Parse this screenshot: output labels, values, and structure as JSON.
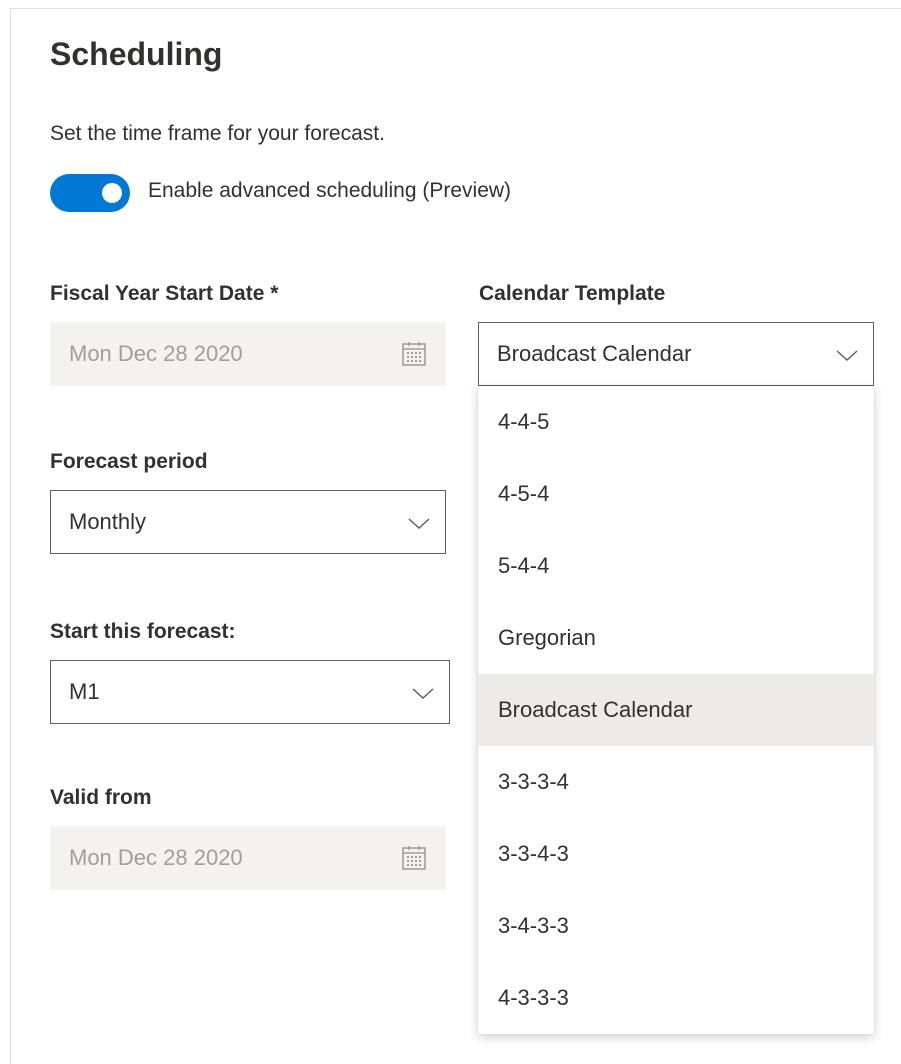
{
  "header": {
    "title": "Scheduling",
    "subtitle": "Set the time frame for your forecast."
  },
  "toggle": {
    "label": "Enable advanced scheduling (Preview)",
    "state": "on",
    "color": "#0078d4"
  },
  "fields": {
    "fiscal_year_start": {
      "label": "Fiscal Year Start Date *",
      "value": "Mon Dec 28 2020",
      "disabled": true,
      "icon": "calendar-icon"
    },
    "calendar_template": {
      "label": "Calendar Template",
      "value": "Broadcast Calendar",
      "icon": "chevron-down-icon",
      "expanded": true
    },
    "forecast_period": {
      "label": "Forecast period",
      "value": "Monthly",
      "icon": "chevron-down-icon"
    },
    "start_forecast": {
      "label": "Start this forecast:",
      "value": "M1",
      "icon": "chevron-down-icon"
    },
    "valid_from": {
      "label": "Valid from",
      "value": "Mon Dec 28 2020",
      "disabled": true,
      "icon": "calendar-icon"
    }
  },
  "dropdown": {
    "options": [
      "4-4-5",
      "4-5-4",
      "5-4-4",
      "Gregorian",
      "Broadcast Calendar",
      "3-3-3-4",
      "3-3-4-3",
      "3-4-3-3",
      "4-3-3-3"
    ],
    "selected": "Broadcast Calendar",
    "selected_background": "#edebe9"
  }
}
